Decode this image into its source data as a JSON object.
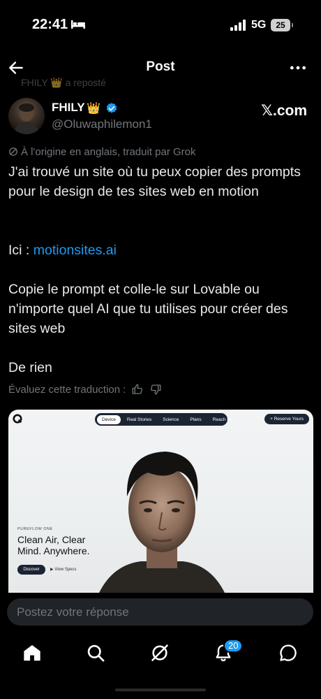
{
  "status_bar": {
    "time": "22:41",
    "network": "5G",
    "battery": "25"
  },
  "header": {
    "title": "Post"
  },
  "repost": {
    "text": "FHILY 👑 a reposté"
  },
  "author": {
    "name": "FHILY",
    "crown": "👑",
    "handle": "@Oluwaphilemon1",
    "watermark": "𝕏.com"
  },
  "post": {
    "translated_note": "À l'origine en anglais, traduit par Grok",
    "line1": "J'ai trouvé un site où tu peux copier des prompts pour le design de tes sites web en motion",
    "link_prefix": "Ici : ",
    "link_text": "motionsites.ai",
    "line3": "Copie le prompt et colle-le sur Lovable ou n'importe quel AI que tu utilises pour créer des sites web",
    "line4": "De rien",
    "rate_prompt": "Évaluez cette traduction :"
  },
  "media": {
    "nav": [
      "Device",
      "Real Stories",
      "Science",
      "Plans",
      "Reach Us"
    ],
    "reserve": "+ Reserve Yours",
    "eyebrow": "PUREFLOW ONE",
    "headline": "Clean Air, Clear Mind. Anywhere.",
    "discover": "Discover",
    "specs": "▶ View Specs"
  },
  "reply": {
    "placeholder": "Postez votre réponse"
  },
  "tabbar": {
    "notification_count": "20"
  },
  "colors": {
    "accent": "#1d9bf0",
    "muted": "#71767b",
    "background": "#000000"
  }
}
